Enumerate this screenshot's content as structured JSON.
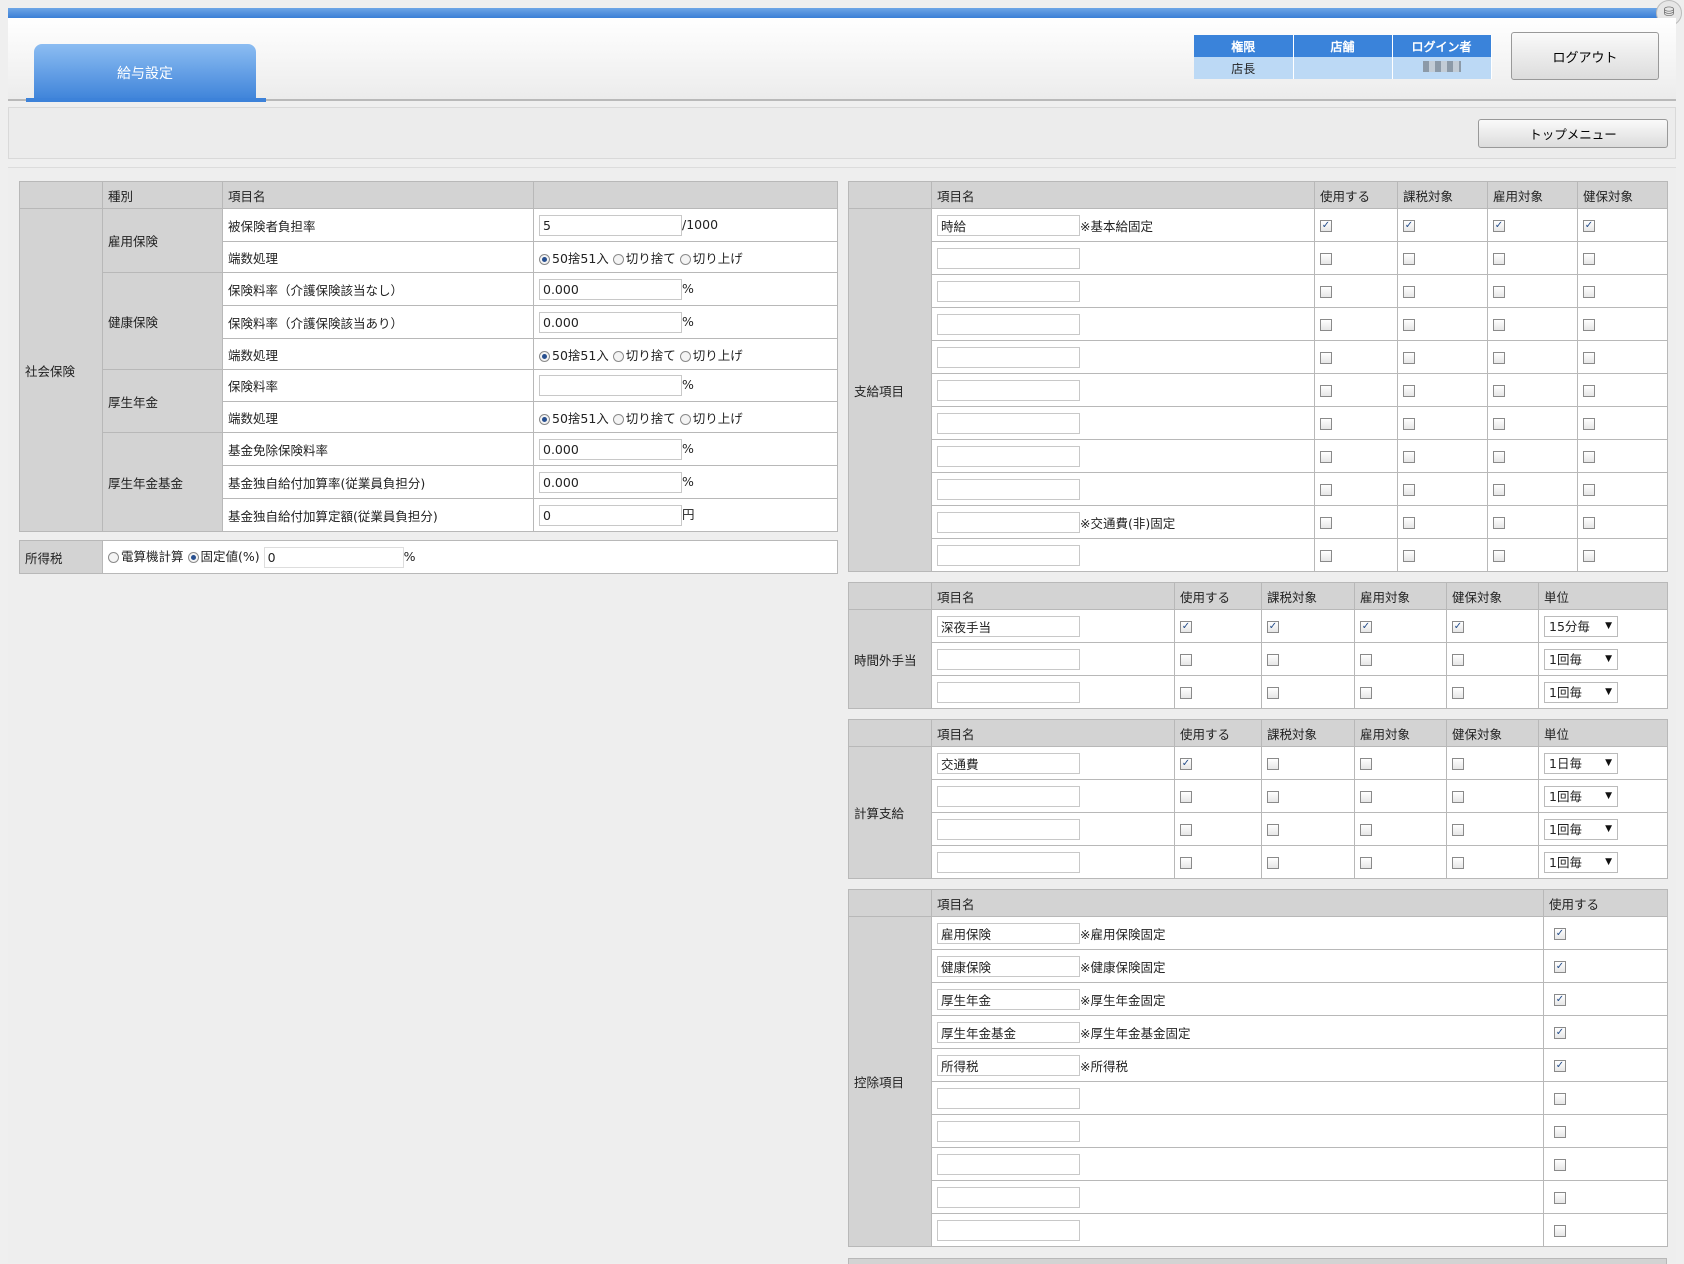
{
  "header": {
    "tab_title": "給与設定",
    "info": {
      "cols": [
        "権限",
        "店舗",
        "ログイン者"
      ],
      "values": [
        "店長",
        "",
        ""
      ]
    },
    "logout_label": "ログアウト",
    "top_menu_label": "トップメニュー",
    "top_icon": "database-icon"
  },
  "insurance": {
    "headers": [
      "種別",
      "項目名",
      ""
    ],
    "section_label": "社会保険",
    "koyo": {
      "label": "雇用保険",
      "rate_label": "被保険者負担率",
      "rate_value": "5",
      "rate_unit": "/1000",
      "round_label": "端数処理"
    },
    "kenko": {
      "label": "健康保険",
      "rate1_label": "保険料率（介護保険該当なし）",
      "rate1_value": "0.000",
      "rate2_label": "保険料率（介護保険該当あり）",
      "rate2_value": "0.000",
      "pct": "%",
      "round_label": "端数処理"
    },
    "kosei": {
      "label": "厚生年金",
      "rate_label": "保険料率",
      "rate_value": "",
      "pct": "%",
      "round_label": "端数処理"
    },
    "kikin": {
      "label": "厚生年金基金",
      "r1_label": "基金免除保険料率",
      "r1_value": "0.000",
      "r2_label": "基金独自給付加算率(従業員負担分)",
      "r2_value": "0.000",
      "r3_label": "基金独自給付加算定額(従業員負担分)",
      "r3_value": "0",
      "pct": "%",
      "yen": "円"
    },
    "rounding_options": [
      "50捨51入",
      "切り捨て",
      "切り上げ"
    ]
  },
  "income_tax": {
    "label": "所得税",
    "opt1": "電算機計算",
    "opt2": "固定値(%)",
    "value": "0",
    "pct": "%"
  },
  "shikyu": {
    "section_label": "支給項目",
    "headers": [
      "項目名",
      "使用する",
      "課税対象",
      "雇用対象",
      "健保対象"
    ],
    "rows": [
      {
        "name": "時給",
        "note": "※基本給固定",
        "use": true,
        "tax": true,
        "emp": true,
        "health": true
      },
      {
        "name": "",
        "note": "",
        "use": false,
        "tax": false,
        "emp": false,
        "health": false
      },
      {
        "name": "",
        "note": "",
        "use": false,
        "tax": false,
        "emp": false,
        "health": false
      },
      {
        "name": "",
        "note": "",
        "use": false,
        "tax": false,
        "emp": false,
        "health": false
      },
      {
        "name": "",
        "note": "",
        "use": false,
        "tax": false,
        "emp": false,
        "health": false
      },
      {
        "name": "",
        "note": "",
        "use": false,
        "tax": false,
        "emp": false,
        "health": false
      },
      {
        "name": "",
        "note": "",
        "use": false,
        "tax": false,
        "emp": false,
        "health": false
      },
      {
        "name": "",
        "note": "",
        "use": false,
        "tax": false,
        "emp": false,
        "health": false
      },
      {
        "name": "",
        "note": "",
        "use": false,
        "tax": false,
        "emp": false,
        "health": false
      },
      {
        "name": "",
        "note": "※交通費(非)固定",
        "use": false,
        "tax": false,
        "emp": false,
        "health": false
      },
      {
        "name": "",
        "note": "",
        "use": false,
        "tax": false,
        "emp": false,
        "health": false
      }
    ]
  },
  "jikangai": {
    "section_label": "時間外手当",
    "headers": [
      "項目名",
      "使用する",
      "課税対象",
      "雇用対象",
      "健保対象",
      "単位"
    ],
    "rows": [
      {
        "name": "深夜手当",
        "use": true,
        "tax": true,
        "emp": true,
        "health": true,
        "unit": "15分毎"
      },
      {
        "name": "",
        "use": false,
        "tax": false,
        "emp": false,
        "health": false,
        "unit": "1回毎"
      },
      {
        "name": "",
        "use": false,
        "tax": false,
        "emp": false,
        "health": false,
        "unit": "1回毎"
      }
    ]
  },
  "keisan": {
    "section_label": "計算支給",
    "headers": [
      "項目名",
      "使用する",
      "課税対象",
      "雇用対象",
      "健保対象",
      "単位"
    ],
    "rows": [
      {
        "name": "交通費",
        "use": true,
        "tax": false,
        "emp": false,
        "health": false,
        "unit": "1日毎"
      },
      {
        "name": "",
        "use": false,
        "tax": false,
        "emp": false,
        "health": false,
        "unit": "1回毎"
      },
      {
        "name": "",
        "use": false,
        "tax": false,
        "emp": false,
        "health": false,
        "unit": "1回毎"
      },
      {
        "name": "",
        "use": false,
        "tax": false,
        "emp": false,
        "health": false,
        "unit": "1回毎"
      }
    ]
  },
  "kojo": {
    "section_label": "控除項目",
    "headers": [
      "項目名",
      "使用する"
    ],
    "rows": [
      {
        "name": "雇用保険",
        "note": "※雇用保険固定",
        "use": true
      },
      {
        "name": "健康保険",
        "note": "※健康保険固定",
        "use": true
      },
      {
        "name": "厚生年金",
        "note": "※厚生年金固定",
        "use": true
      },
      {
        "name": "厚生年金基金",
        "note": "※厚生年金基金固定",
        "use": true
      },
      {
        "name": "所得税",
        "note": "※所得税",
        "use": true
      },
      {
        "name": "",
        "note": "",
        "use": false
      },
      {
        "name": "",
        "note": "",
        "use": false
      },
      {
        "name": "",
        "note": "",
        "use": false
      },
      {
        "name": "",
        "note": "",
        "use": false
      },
      {
        "name": "",
        "note": "",
        "use": false
      }
    ]
  }
}
